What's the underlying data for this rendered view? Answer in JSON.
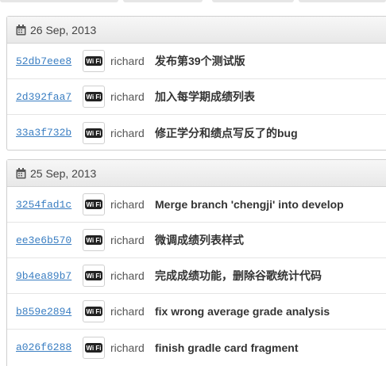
{
  "groups": [
    {
      "date": "26 Sep, 2013",
      "commits": [
        {
          "sha": "52db7eee8",
          "author": "richard",
          "message": "发布第39个测试版"
        },
        {
          "sha": "2d392faa7",
          "author": "richard",
          "message": "加入每学期成绩列表"
        },
        {
          "sha": "33a3f732b",
          "author": "richard",
          "message": "修正学分和绩点写反了的bug"
        }
      ]
    },
    {
      "date": "25 Sep, 2013",
      "commits": [
        {
          "sha": "3254fad1c",
          "author": "richard",
          "message": "Merge branch 'chengji' into develop"
        },
        {
          "sha": "ee3e6b570",
          "author": "richard",
          "message": "微调成绩列表样式"
        },
        {
          "sha": "9b4ea89b7",
          "author": "richard",
          "message": "完成成绩功能，删除谷歌统计代码"
        },
        {
          "sha": "b859e2894",
          "author": "richard",
          "message": "fix wrong average grade analysis"
        },
        {
          "sha": "a026f6288",
          "author": "richard",
          "message": "finish gradle card fragment"
        }
      ]
    }
  ],
  "icons": {
    "calendar": "calendar-icon",
    "avatar": "wifi-avatar-icon"
  },
  "colors": {
    "sha_link": "#3a7ec2",
    "header_bg": "#eeeeee",
    "border": "#cfcfcf"
  }
}
